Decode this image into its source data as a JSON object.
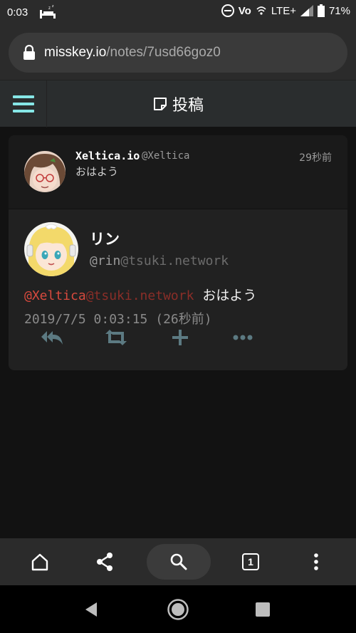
{
  "status_bar": {
    "time": "0:03",
    "network": "LTE+",
    "volte": "Vo",
    "battery": "71%"
  },
  "url_bar": {
    "host": "misskey.io",
    "path": "/notes/7usd66goz0"
  },
  "header": {
    "title": "投稿"
  },
  "reply_note": {
    "name": "Xeltica.io",
    "username": "@Xeltica",
    "time": "29秒前",
    "text": "おはよう"
  },
  "main_note": {
    "name": "リン",
    "username_user": "@rin",
    "username_host": "@tsuki.network",
    "mention_user": "@Xeltica",
    "mention_host": "@tsuki.network",
    "text": "おはよう",
    "datetime": "2019/7/5 0:03:15 (26秒前)"
  },
  "toolbar": {
    "tab_count": "1"
  },
  "colors": {
    "accent": "#86e6e6",
    "mention": "#d84a3e",
    "background": "#121212"
  }
}
